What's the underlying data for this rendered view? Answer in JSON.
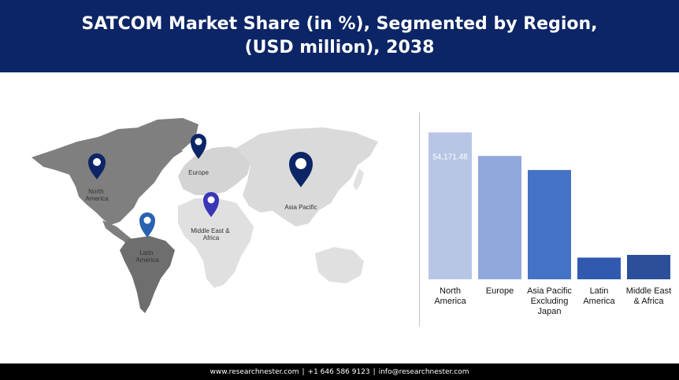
{
  "header": {
    "title": "SATCOM Market Share (in %), Segmented by Region, (USD million), 2038"
  },
  "map": {
    "markers": [
      {
        "id": "north-america",
        "label_lines": [
          "North",
          "America"
        ],
        "color": "#0c2566"
      },
      {
        "id": "europe",
        "label_lines": [
          "Europe"
        ],
        "color": "#0c2566"
      },
      {
        "id": "asia-pacific",
        "label_lines": [
          "Asia Pacific"
        ],
        "color": "#0c2566"
      },
      {
        "id": "middle-east-africa",
        "label_lines": [
          "Middle East &",
          "Africa"
        ],
        "color": "#3a36b8"
      },
      {
        "id": "latin-america",
        "label_lines": [
          "Latin",
          "America"
        ],
        "color": "#2a62b0"
      }
    ]
  },
  "chart_data": {
    "type": "bar",
    "categories": [
      "North America",
      "Europe",
      "Asia Pacific Excluding Japan",
      "Latin America",
      "Middle East & Africa"
    ],
    "category_label_lines": [
      [
        "North",
        "America"
      ],
      [
        "Europe"
      ],
      [
        "Asia Pacific",
        "Excluding",
        "Japan"
      ],
      [
        "Latin",
        "America"
      ],
      [
        "Middle East",
        "& Africa"
      ]
    ],
    "values": [
      54171.48,
      45500,
      40300,
      8000,
      9000
    ],
    "data_labels": [
      "54,171.48",
      "",
      "",
      "",
      ""
    ],
    "colors": [
      "#b7c6e5",
      "#91a8dc",
      "#4472c4",
      "#2f5ab0",
      "#2c4f9a"
    ],
    "ylim": [
      0,
      56000
    ]
  },
  "footer": {
    "website": "www.researchnester.com",
    "phone": "+1 646 586 9123",
    "email": "info@researchnester.com"
  }
}
